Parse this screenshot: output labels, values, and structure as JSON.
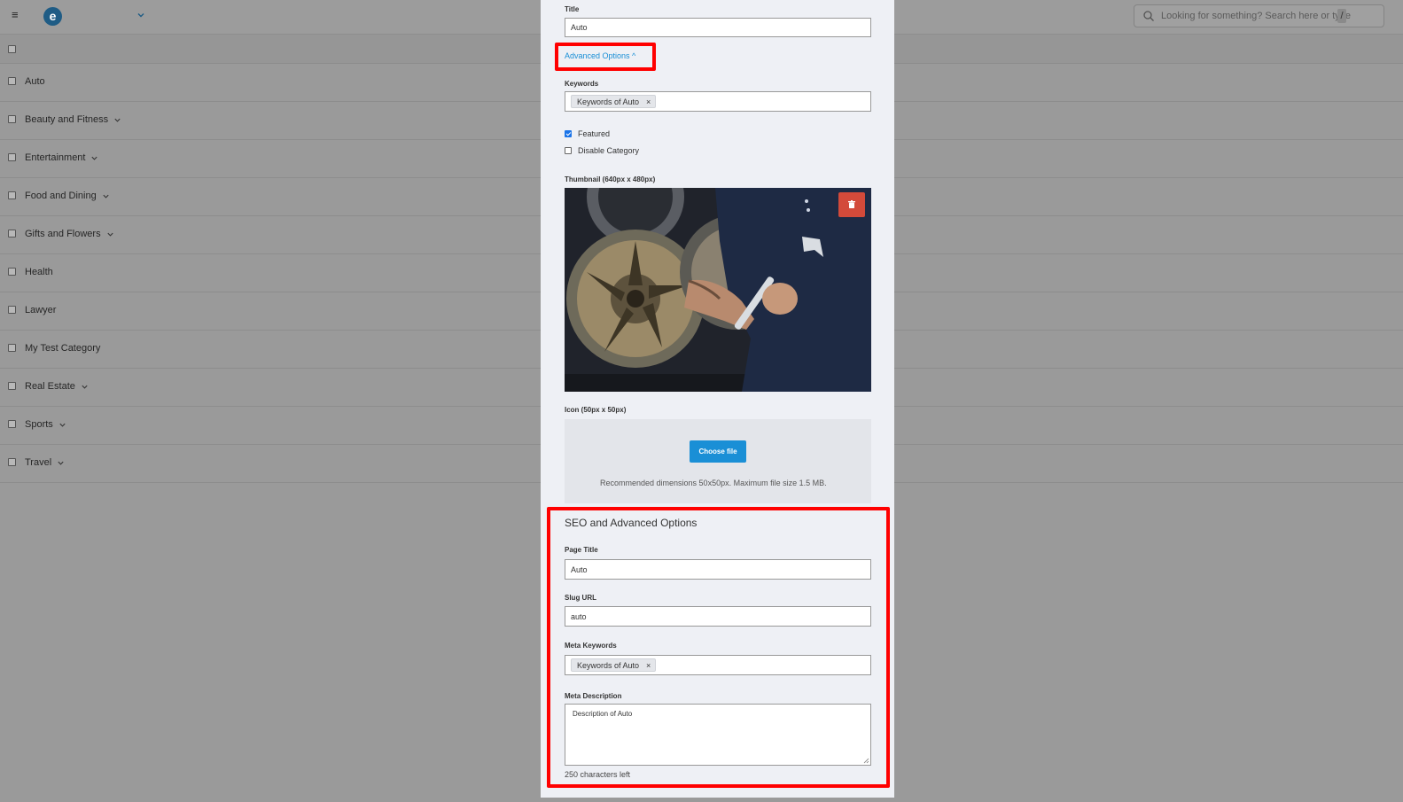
{
  "app": {
    "logo_letter": "e",
    "search_placeholder": "Looking for something? Search here or type",
    "search_shortcut": "/"
  },
  "categories": [
    {
      "name": "Auto",
      "has_children": false
    },
    {
      "name": "Beauty and Fitness",
      "has_children": true
    },
    {
      "name": "Entertainment",
      "has_children": true
    },
    {
      "name": "Food and Dining",
      "has_children": true
    },
    {
      "name": "Gifts and Flowers",
      "has_children": true
    },
    {
      "name": "Health",
      "has_children": false
    },
    {
      "name": "Lawyer",
      "has_children": false
    },
    {
      "name": "My Test Category",
      "has_children": false
    },
    {
      "name": "Real Estate",
      "has_children": true
    },
    {
      "name": "Sports",
      "has_children": true
    },
    {
      "name": "Travel",
      "has_children": true
    }
  ],
  "modal": {
    "title_label": "Title",
    "title_value": "Auto",
    "advanced_options_label": "Advanced Options ^",
    "keywords_label": "Keywords",
    "keywords_tag": "Keywords of Auto",
    "tag_remove": "×",
    "featured_label": "Featured",
    "featured_checked": true,
    "disable_label": "Disable Category",
    "disable_checked": false,
    "thumbnail_label": "Thumbnail (640px x 480px)",
    "icon_label": "Icon (50px x 50px)",
    "choose_file_label": "Choose file",
    "recommended_text": "Recommended dimensions 50x50px. Maximum file size 1.5 MB.",
    "seo_title": "SEO and Advanced Options",
    "page_title_label": "Page Title",
    "page_title_value": "Auto",
    "slug_label": "Slug URL",
    "slug_value": "auto",
    "meta_keywords_label": "Meta Keywords",
    "meta_keywords_tag": "Keywords of Auto",
    "meta_description_label": "Meta Description",
    "meta_description_value": "Description of Auto",
    "chars_left": "250 characters left"
  },
  "colors": {
    "accent": "#1a8fd6",
    "highlight": "#ff0000",
    "danger": "#d34a3a"
  }
}
